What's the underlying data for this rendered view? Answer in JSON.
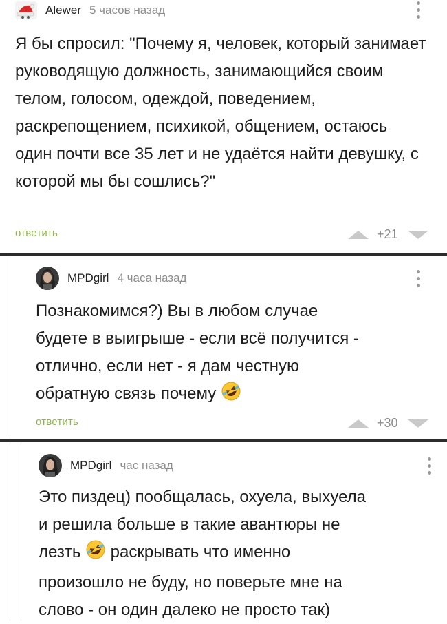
{
  "comments": [
    {
      "author": "Alewer",
      "time": "5 часов назад",
      "text": "Я бы спросил: \"Почему я, человек, который занимает руководящую должность, занимающийся своим телом, голосом, одеждой, поведением, раскрепощением, психикой, общением, остаюсь один почти все 35 лет и не удаётся найти девушку, с которой мы бы сошлись?\"",
      "reply_label": "ответить",
      "rating": "+21",
      "avatar": "santa-hat-avatar-icon"
    },
    {
      "author": "MPDgirl",
      "time": "4 часа назад",
      "text_lines": [
        "Познакомимся?) Вы в любом случае",
        "будете в выигрыше - если всё получится -",
        "отлично, если нет - я дам честную",
        "обратную связь почему"
      ],
      "reply_label": "ответить",
      "rating": "+30",
      "avatar": "girl-portrait-avatar-icon",
      "emoji": "rolling-laughing-emoji-icon"
    },
    {
      "author": "MPDgirl",
      "time": "час назад",
      "text_lines": [
        "Это пиздец) пообщалась, охуела, выхуела",
        "и решила больше в такие авантюры не",
        "лезть",
        "раскрывать что именно",
        "произошло не буду, но поверьте мне на",
        "слово - он один далеко не просто так)"
      ],
      "avatar": "girl-portrait-avatar-icon",
      "emoji": "rolling-laughing-emoji-icon"
    }
  ],
  "colors": {
    "reply": "#8db54a",
    "divider": "#2c2c2c",
    "meta": "#8d8d8d"
  }
}
